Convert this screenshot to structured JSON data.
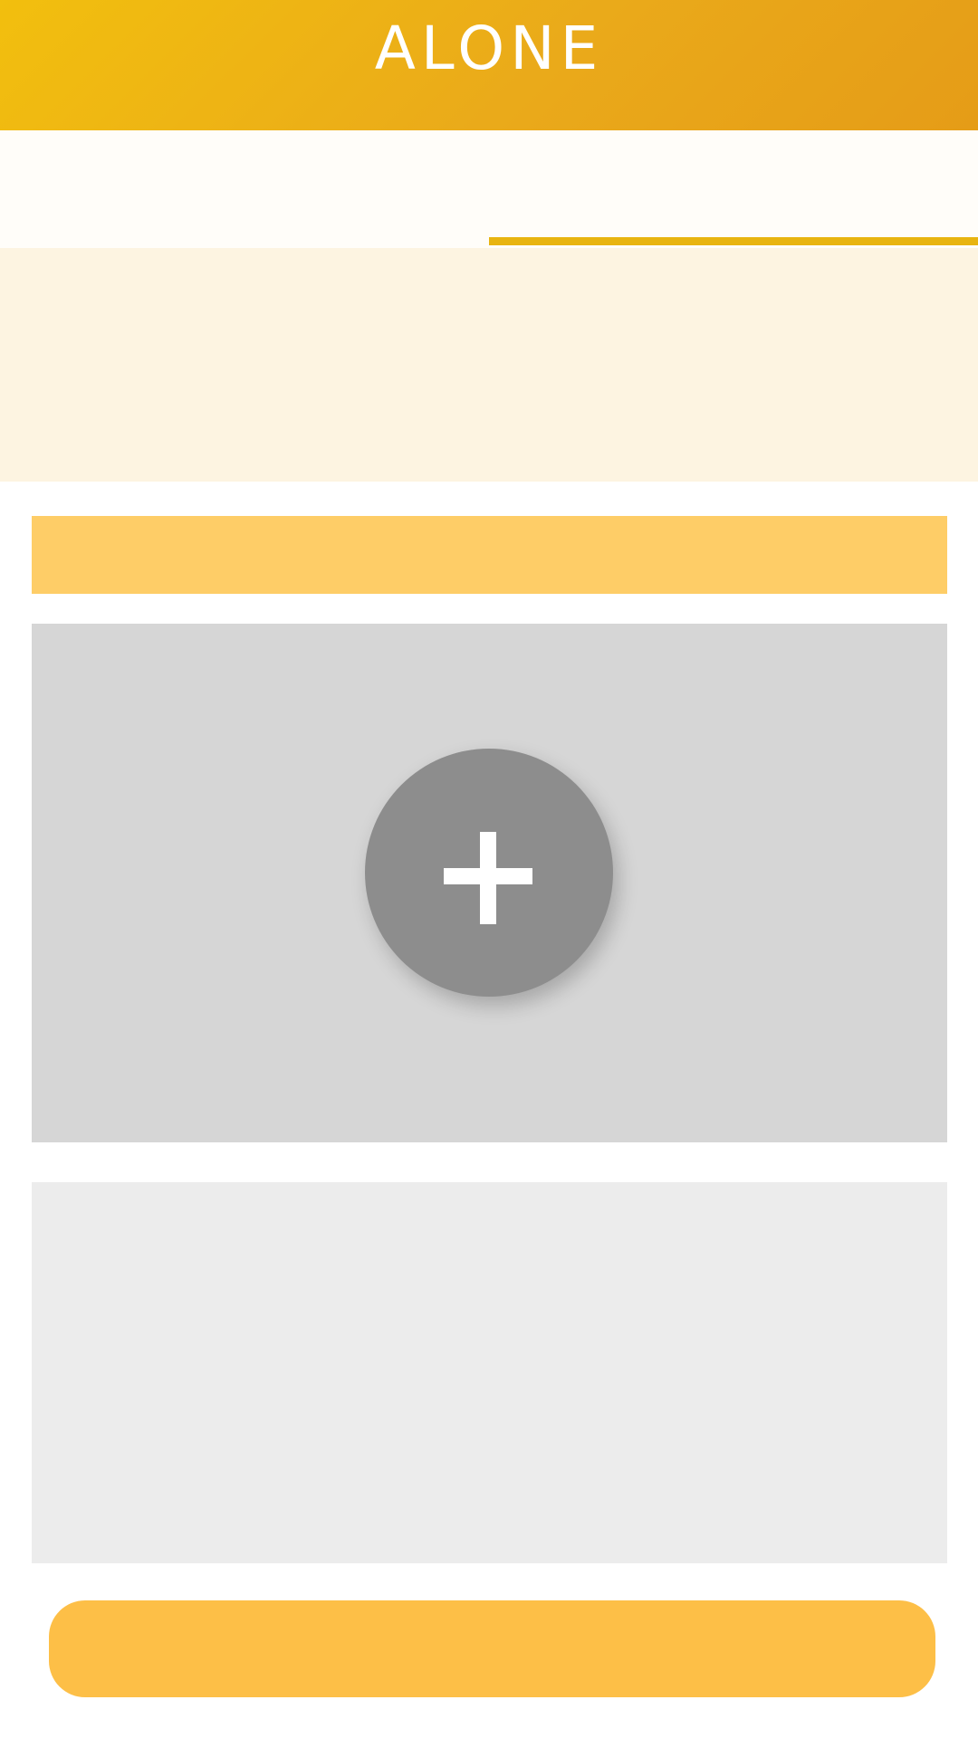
{
  "header": {
    "title": "ALONE"
  },
  "tabs": [
    {
      "label": ""
    },
    {
      "label": "",
      "selected": true
    }
  ],
  "banner": {
    "text": ""
  },
  "section_bar": {
    "text": ""
  },
  "media": {
    "add_icon": "plus-icon"
  },
  "text_area": {
    "value": "",
    "placeholder": ""
  },
  "submit": {
    "label": ""
  },
  "colors": {
    "header_start": "#f2bf0e",
    "header_end": "#e59c17",
    "tab_indicator": "#e8b410",
    "banner_bg": "#fdf4e1",
    "section_bar": "#fecd67",
    "media_bg": "#d6d6d6",
    "add_button": "#8d8d8d",
    "text_area_bg": "#ececec",
    "submit_button": "#fdbf47"
  }
}
